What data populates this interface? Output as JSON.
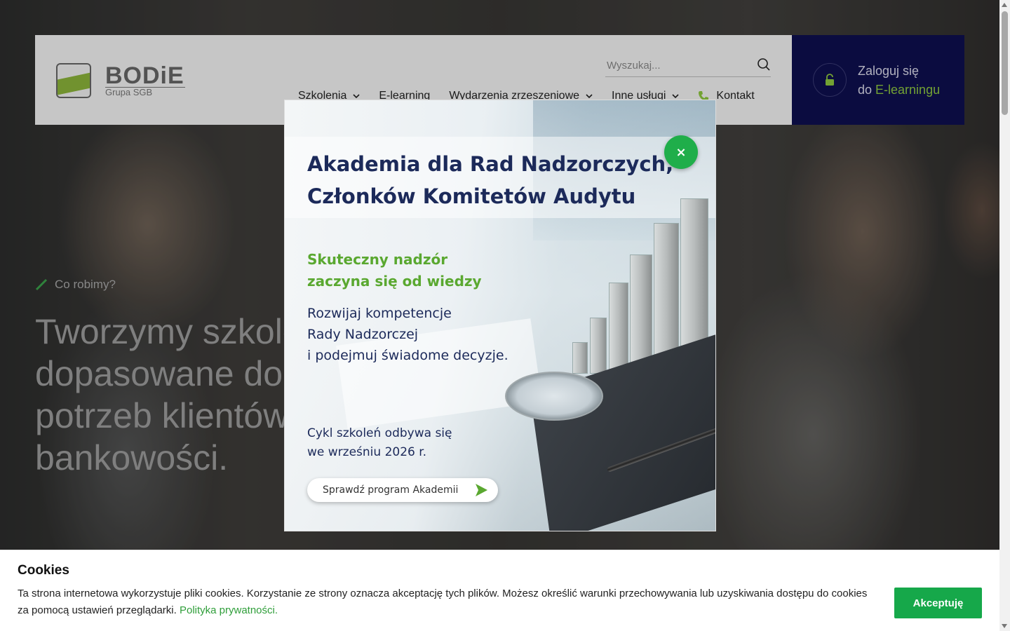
{
  "header": {
    "logo": {
      "title": "BODiE",
      "subtitle": "Grupa SGB"
    },
    "search": {
      "placeholder": "Wyszukaj..."
    },
    "nav": [
      {
        "label": "Szkolenia",
        "has_dropdown": true
      },
      {
        "label": "E-learning",
        "has_dropdown": false
      },
      {
        "label": "Wydarzenia zrzeszeniowe",
        "has_dropdown": true
      },
      {
        "label": "Inne usługi",
        "has_dropdown": true
      },
      {
        "label": "Kontakt",
        "icon": "phone-icon"
      }
    ],
    "login": {
      "line1": "Zaloguj się",
      "line2_prefix": "do ",
      "line2_accent": "E-learningu"
    }
  },
  "hero": {
    "eyebrow": "Co robimy?",
    "title_lines": [
      "Tworzymy szkolenia",
      "dopasowane do",
      "potrzeb klientów",
      "bankowości."
    ]
  },
  "modal": {
    "title_lines": [
      "Akademia dla Rad Nadzorczych,",
      "Członków Komitetów Audytu"
    ],
    "green_lines": [
      "Skuteczny nadzór",
      "zaczyna się od wiedzy"
    ],
    "body_lines": [
      "Rozwijaj kompetencje",
      "Rady Nadzorczej",
      "i podejmuj świadome decyzje."
    ],
    "date_lines": [
      "Cykl szkoleń odbywa się",
      "we wrześniu 2026 r."
    ],
    "button_label": "Sprawdź program Akademii",
    "close_label": "×"
  },
  "cookies": {
    "title": "Cookies",
    "text": "Ta strona internetowa wykorzystuje pliki cookies. Korzystanie ze strony oznacza akceptację tych plików. Możesz określić warunki przechowywania lub uzyskiwania dostępu do cookies za pomocą ustawień przeglądarki.",
    "link": "Polityka prywatności.",
    "accept_label": "Akceptuję"
  },
  "colors": {
    "accent_green": "#8dc63f",
    "button_green": "#16a84a",
    "login_bg": "#0e0f4f",
    "modal_title": "#1c2a5a"
  }
}
